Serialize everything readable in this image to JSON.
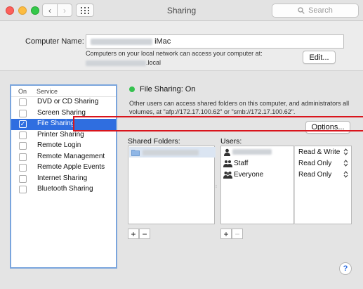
{
  "window": {
    "title": "Sharing",
    "search_placeholder": "Search",
    "back_glyph": "‹",
    "forward_glyph": "›"
  },
  "computer_name": {
    "label": "Computer Name:",
    "value_suffix": "iMac",
    "description_line1": "Computers on your local network can access your computer at:",
    "address_suffix": ".local",
    "edit_label": "Edit..."
  },
  "services": {
    "header_on": "On",
    "header_service": "Service",
    "items": [
      {
        "label": "DVD or CD Sharing",
        "checked": false,
        "selected": false
      },
      {
        "label": "Screen Sharing",
        "checked": false,
        "selected": false
      },
      {
        "label": "File Sharing",
        "checked": true,
        "selected": true
      },
      {
        "label": "Printer Sharing",
        "checked": false,
        "selected": false
      },
      {
        "label": "Remote Login",
        "checked": false,
        "selected": false
      },
      {
        "label": "Remote Management",
        "checked": false,
        "selected": false
      },
      {
        "label": "Remote Apple Events",
        "checked": false,
        "selected": false
      },
      {
        "label": "Internet Sharing",
        "checked": false,
        "selected": false
      },
      {
        "label": "Bluetooth Sharing",
        "checked": false,
        "selected": false
      }
    ]
  },
  "file_sharing": {
    "status": "File Sharing: On",
    "status_color": "#35c24f",
    "description": "Other users can access shared folders on this computer, and administrators all volumes, at \"afp://172.17.100.62\" or \"smb://172.17.100.62\".",
    "options_label": "Options...",
    "shared_folders_label": "Shared Folders:",
    "users_label": "Users:",
    "users": [
      {
        "name": "",
        "icon": "user-icon",
        "permission": "Read & Write"
      },
      {
        "name": "Staff",
        "icon": "group-icon",
        "permission": "Read Only"
      },
      {
        "name": "Everyone",
        "icon": "everyone-icon",
        "permission": "Read Only"
      }
    ],
    "plus": "+",
    "minus": "−"
  },
  "help_glyph": "?",
  "accent_color": "#2f6ee0",
  "annotation_color": "#d9141c"
}
